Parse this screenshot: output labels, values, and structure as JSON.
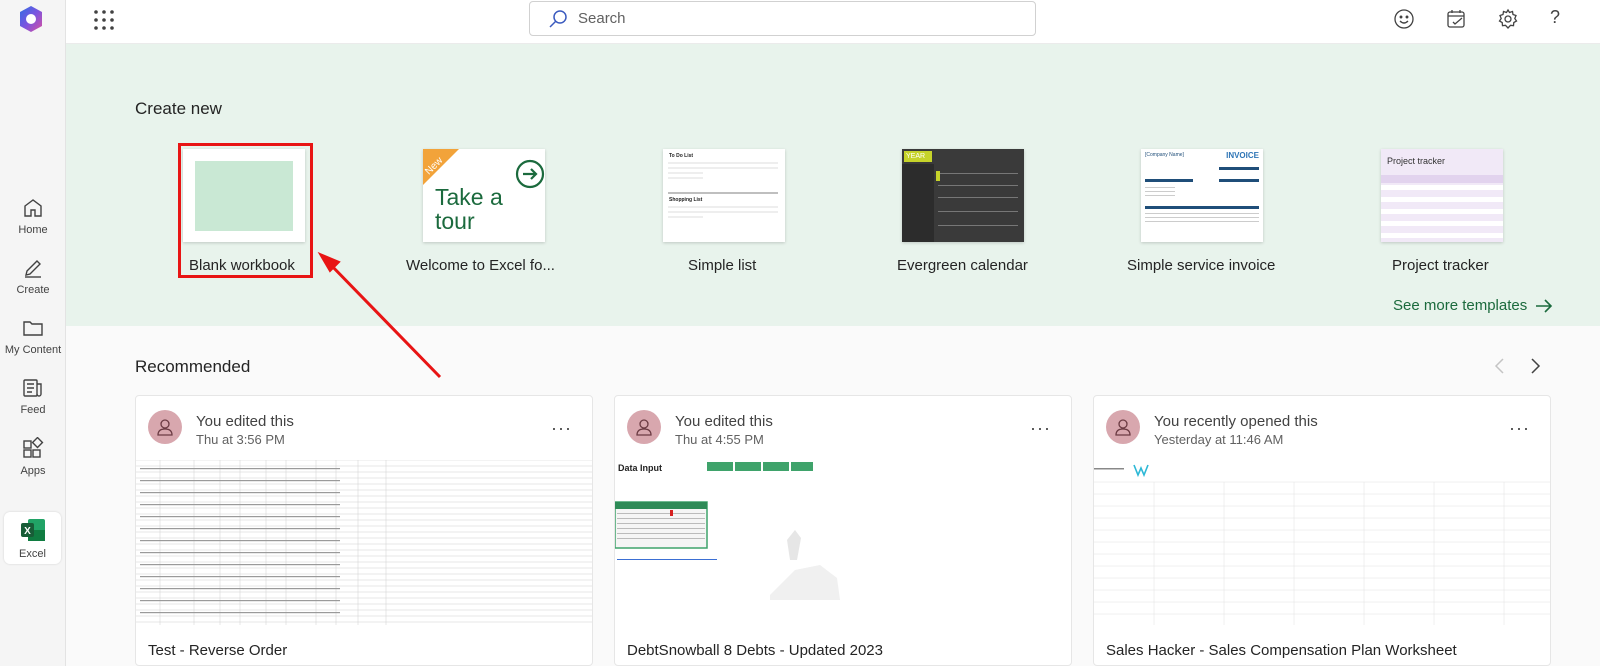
{
  "search": {
    "placeholder": "Search"
  },
  "rail": {
    "items": [
      {
        "label": "Home"
      },
      {
        "label": "Create"
      },
      {
        "label": "My Content"
      },
      {
        "label": "Feed"
      },
      {
        "label": "Apps"
      },
      {
        "label": "Excel"
      }
    ]
  },
  "create_new": {
    "title": "Create new",
    "templates": [
      {
        "label": "Blank workbook"
      },
      {
        "label": "Welcome to Excel fo...",
        "badge": "New",
        "thumb_text": "Take a tour"
      },
      {
        "label": "Simple list",
        "thumb_text_1": "To Do List",
        "thumb_text_2": "Shopping List"
      },
      {
        "label": "Evergreen calendar",
        "thumb_text": "YEAR"
      },
      {
        "label": "Simple service invoice",
        "thumb_text_1": "[Company Name]",
        "thumb_text_2": "INVOICE"
      },
      {
        "label": "Project tracker",
        "thumb_text": "Project tracker"
      }
    ],
    "see_more": "See more templates"
  },
  "recommended": {
    "title": "Recommended",
    "cards": [
      {
        "activity": "You edited this",
        "time": "Thu at 3:56 PM",
        "name": "Test - Reverse Order"
      },
      {
        "activity": "You edited this",
        "time": "Thu at 4:55 PM",
        "name": "DebtSnowball 8 Debts - Updated 2023",
        "preview_title": "Data Input"
      },
      {
        "activity": "You recently opened this",
        "time": "Yesterday at 11:46 AM",
        "name": "Sales Hacker - Sales Compensation Plan Worksheet"
      }
    ]
  },
  "colors": {
    "accent_green": "#1b6a3d",
    "band": "#e8f3ec",
    "highlight_red": "#e81414",
    "avatar": "#d8a7ae"
  }
}
